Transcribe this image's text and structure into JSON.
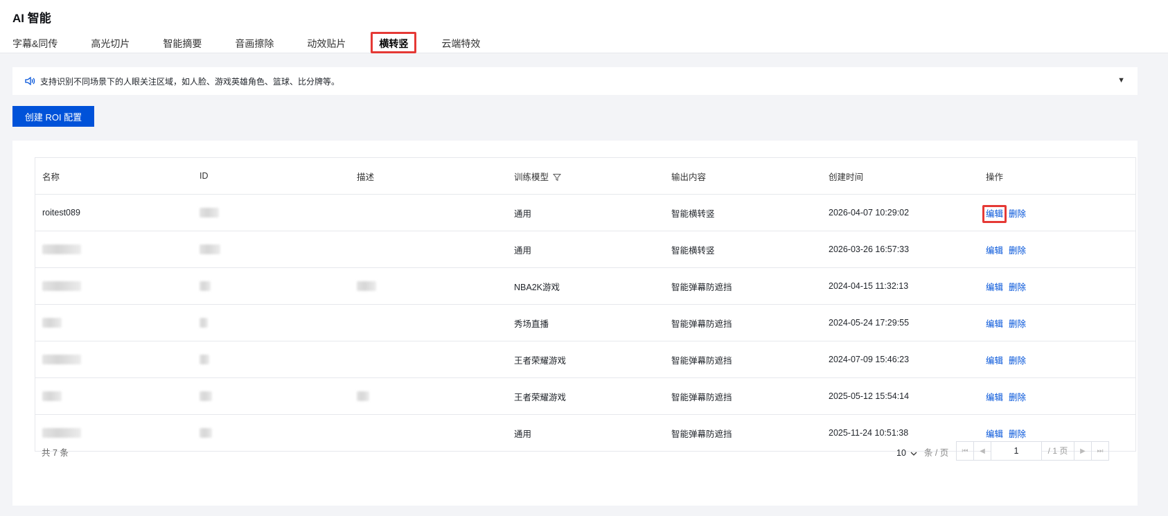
{
  "header": {
    "title": "AI 智能",
    "tabs": [
      {
        "label": "字幕&同传"
      },
      {
        "label": "高光切片"
      },
      {
        "label": "智能摘要"
      },
      {
        "label": "音画擦除"
      },
      {
        "label": "动效贴片"
      },
      {
        "label": "横转竖"
      },
      {
        "label": "云端特效"
      }
    ],
    "active_tab": "横转竖"
  },
  "notice": {
    "text": "支持识别不同场景下的人眼关注区域，如人脸、游戏英雄角色、篮球、比分牌等。",
    "toggle": "▼",
    "icon": "speaker-icon"
  },
  "actions": {
    "create_label": "创建 ROI 配置"
  },
  "table": {
    "columns": [
      "名称",
      "ID",
      "描述",
      "训练模型",
      "输出内容",
      "创建时间",
      "操作"
    ],
    "rows": [
      {
        "name": "roitest089",
        "model": "通用",
        "output": "智能横转竖",
        "created": "2026-04-07 10:29:02"
      },
      {
        "name": "",
        "model": "通用",
        "output": "智能横转竖",
        "created": "2026-03-26 16:57:33"
      },
      {
        "name": "",
        "model": "NBA2K游戏",
        "output": "智能弹幕防遮挡",
        "created": "2024-04-15 11:32:13"
      },
      {
        "name": "",
        "model": "秀场直播",
        "output": "智能弹幕防遮挡",
        "created": "2024-05-24 17:29:55"
      },
      {
        "name": "",
        "model": "王者荣耀游戏",
        "output": "智能弹幕防遮挡",
        "created": "2024-07-09 15:46:23"
      },
      {
        "name": "",
        "model": "王者荣耀游戏",
        "output": "智能弹幕防遮挡",
        "created": "2025-05-12 15:54:14"
      },
      {
        "name": "",
        "model": "通用",
        "output": "智能弹幕防遮挡",
        "created": "2025-11-24 10:51:38"
      }
    ],
    "edit_label": "编辑",
    "delete_label": "删除"
  },
  "footer": {
    "total": "共 7 条",
    "page_size": "10",
    "page_size_unit": "条 / 页",
    "current_page": "1",
    "total_pages": "/ 1 页"
  },
  "colors": {
    "primary": "#0052d9",
    "highlight": "#e53935"
  }
}
